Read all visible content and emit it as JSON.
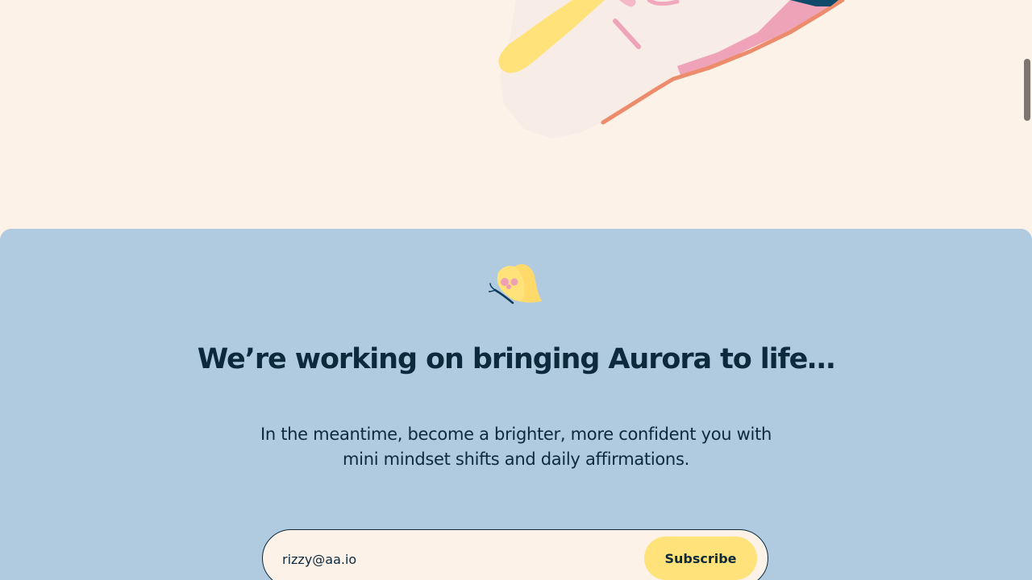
{
  "hero": {
    "illustration_icon": "hand-holding-pencil-illustration"
  },
  "signup_section": {
    "icon": "butterfly-icon",
    "title": "We’re working on bringing Aurora to life…",
    "subtitle": "In the meantime, become a brighter, more confident you with mini mindset shifts and daily affirmations.",
    "email_value": "rizzy@aa.io",
    "subscribe_label": "Subscribe"
  },
  "colors": {
    "page_background": "#fcf2e8",
    "panel_background": "#b0cae0",
    "text": "#0d2a3d",
    "button": "#ffe27a"
  }
}
